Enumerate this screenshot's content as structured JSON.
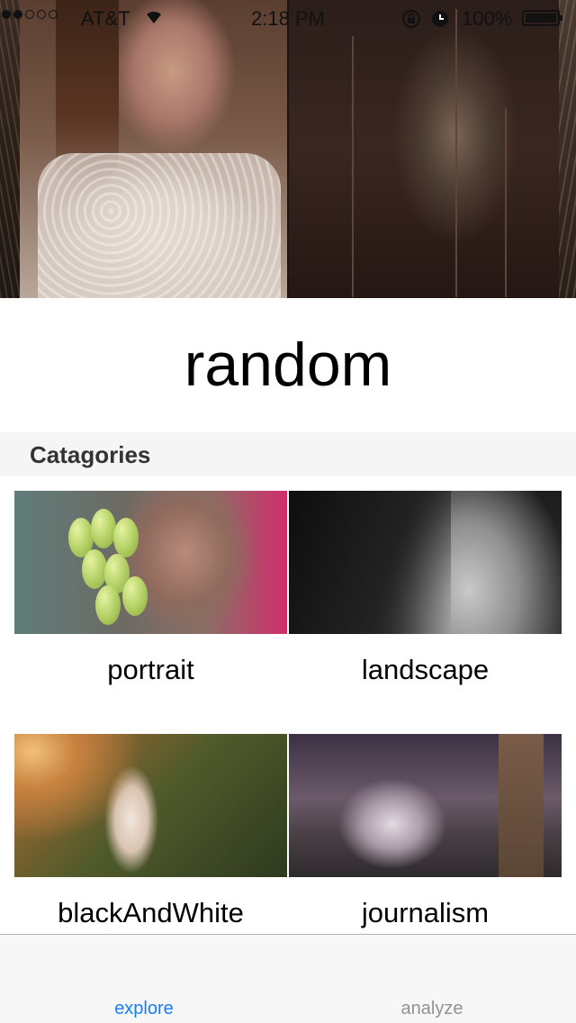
{
  "status_bar": {
    "carrier": "AT&T",
    "time": "2:18 PM",
    "battery_percent": "100%",
    "signal_bars_filled": 2,
    "signal_bars_total": 5,
    "icons": [
      "wifi-icon",
      "orientation-lock-icon",
      "alarm-icon",
      "battery-icon"
    ]
  },
  "page": {
    "title": "random"
  },
  "categories_section": {
    "header": "Catagories",
    "items": [
      {
        "label": "portrait",
        "image": "girl-holding-grapes-photo"
      },
      {
        "label": "landscape",
        "image": "black-and-white-face-photo"
      },
      {
        "label": "blackAndWhite",
        "image": "woman-in-forest-sunlight-photo"
      },
      {
        "label": "journalism",
        "image": "woman-sitting-on-ruins-photo"
      }
    ]
  },
  "tab_bar": {
    "tabs": [
      {
        "label": "explore",
        "active": true
      },
      {
        "label": "analyze",
        "active": false
      }
    ],
    "active_color": "#157efb",
    "inactive_color": "#929292"
  }
}
